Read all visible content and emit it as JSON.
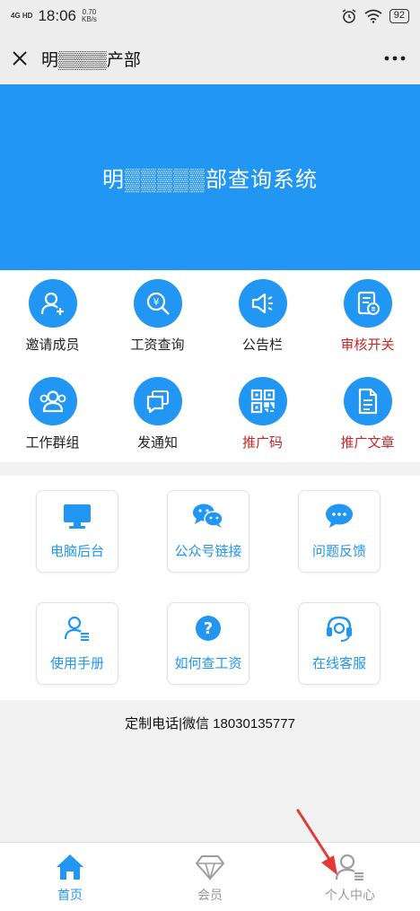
{
  "status_bar": {
    "network": "4G HD",
    "time": "18:06",
    "speed_value": "0.70",
    "speed_unit": "KB/s",
    "battery": "92"
  },
  "title_bar": {
    "title": "明▒▒▒▒产部"
  },
  "banner": {
    "title": "明▒▒▒▒▒部查询系统"
  },
  "grid": [
    {
      "label": "邀请成员",
      "icon": "add-user-icon"
    },
    {
      "label": "工资查询",
      "icon": "salary-search-icon"
    },
    {
      "label": "公告栏",
      "icon": "megaphone-icon"
    },
    {
      "label": "审核开关",
      "icon": "audit-icon",
      "highlight": true
    },
    {
      "label": "工作群组",
      "icon": "group-icon"
    },
    {
      "label": "发通知",
      "icon": "message-icon"
    },
    {
      "label": "推广码",
      "icon": "qr-code-icon",
      "highlight": true
    },
    {
      "label": "推广文章",
      "icon": "document-icon",
      "highlight": true
    }
  ],
  "cards": [
    {
      "label": "电脑后台",
      "icon": "monitor-icon"
    },
    {
      "label": "公众号链接",
      "icon": "wechat-icon"
    },
    {
      "label": "问题反馈",
      "icon": "chat-bubble-icon"
    },
    {
      "label": "使用手册",
      "icon": "user-manual-icon"
    },
    {
      "label": "如何查工资",
      "icon": "question-icon"
    },
    {
      "label": "在线客服",
      "icon": "headset-icon"
    }
  ],
  "contact": "定制电话|微信 18030135777",
  "bottom_nav": [
    {
      "label": "首页",
      "icon": "home-icon",
      "active": true
    },
    {
      "label": "会员",
      "icon": "diamond-icon",
      "active": false
    },
    {
      "label": "个人中心",
      "icon": "person-icon",
      "active": false
    }
  ],
  "colors": {
    "primary": "#2196f3",
    "highlight_text": "#c62828",
    "arrow": "#e53935"
  }
}
